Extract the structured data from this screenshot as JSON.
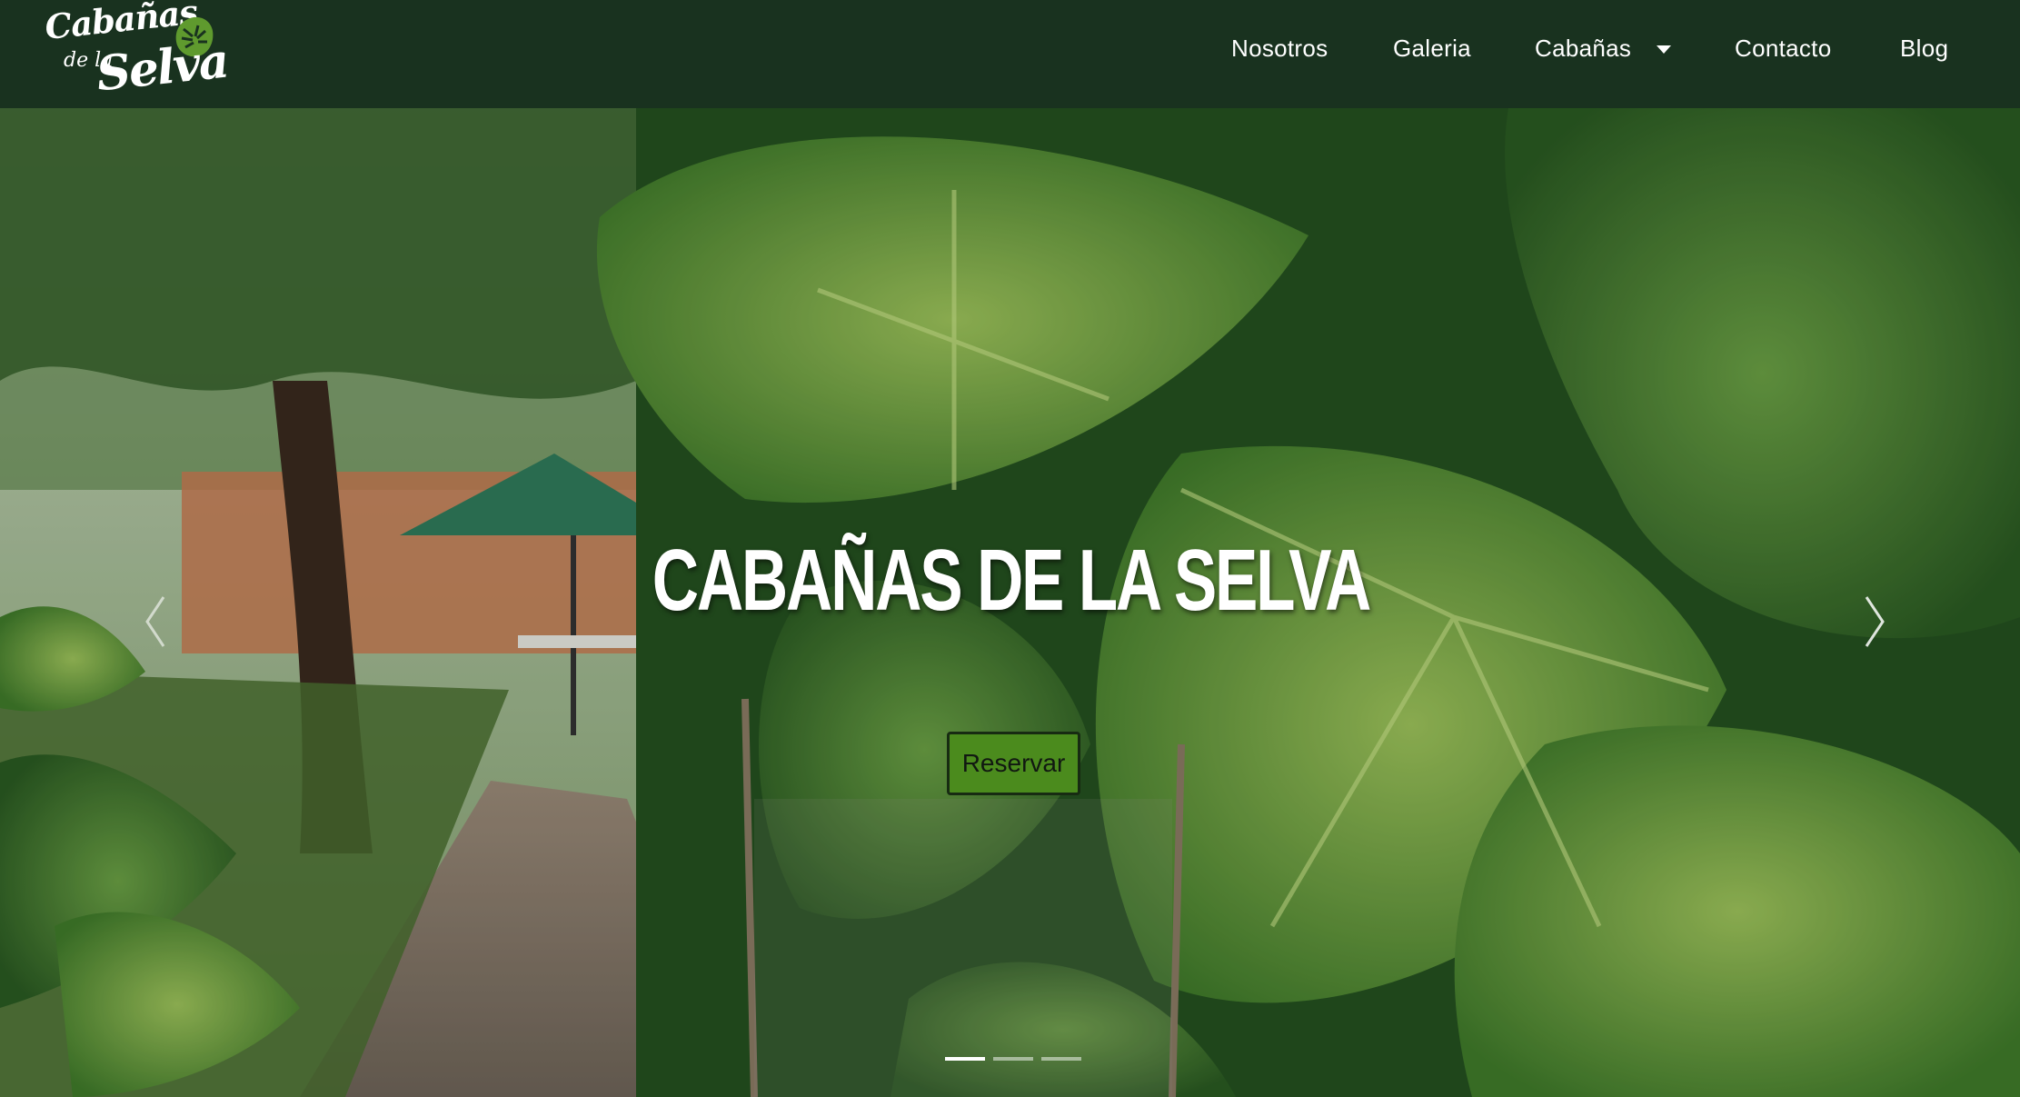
{
  "brand": {
    "logo_line1": "Cabañas",
    "logo_line2": "de la",
    "logo_line3": "Selva"
  },
  "nav": {
    "items": [
      {
        "label": "Nosotros"
      },
      {
        "label": "Galeria"
      },
      {
        "label": "Cabañas",
        "dropdown": true
      },
      {
        "label": "Contacto"
      },
      {
        "label": "Blog"
      }
    ]
  },
  "hero": {
    "title": "CABAÑAS DE LA SELVA",
    "button_label": "Reservar",
    "prev_icon": "chevron-left-icon",
    "next_icon": "chevron-right-icon",
    "slides": 3,
    "active_slide": 1
  },
  "colors": {
    "navbar_bg": "#19321f",
    "button_bg": "#4b8b1d",
    "text": "#ffffff"
  }
}
